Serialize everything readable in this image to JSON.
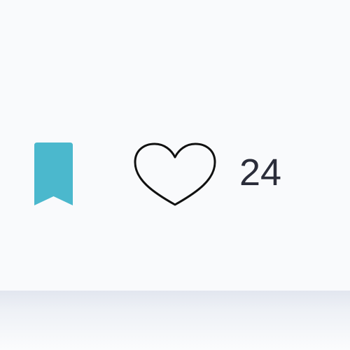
{
  "actions": {
    "bookmark": {
      "icon": "bookmark-icon",
      "saved": true,
      "color": "#4bb8cd"
    },
    "like": {
      "icon": "heart-outline-icon",
      "liked": false,
      "count": "24",
      "count_color": "#2b2d3a"
    }
  }
}
